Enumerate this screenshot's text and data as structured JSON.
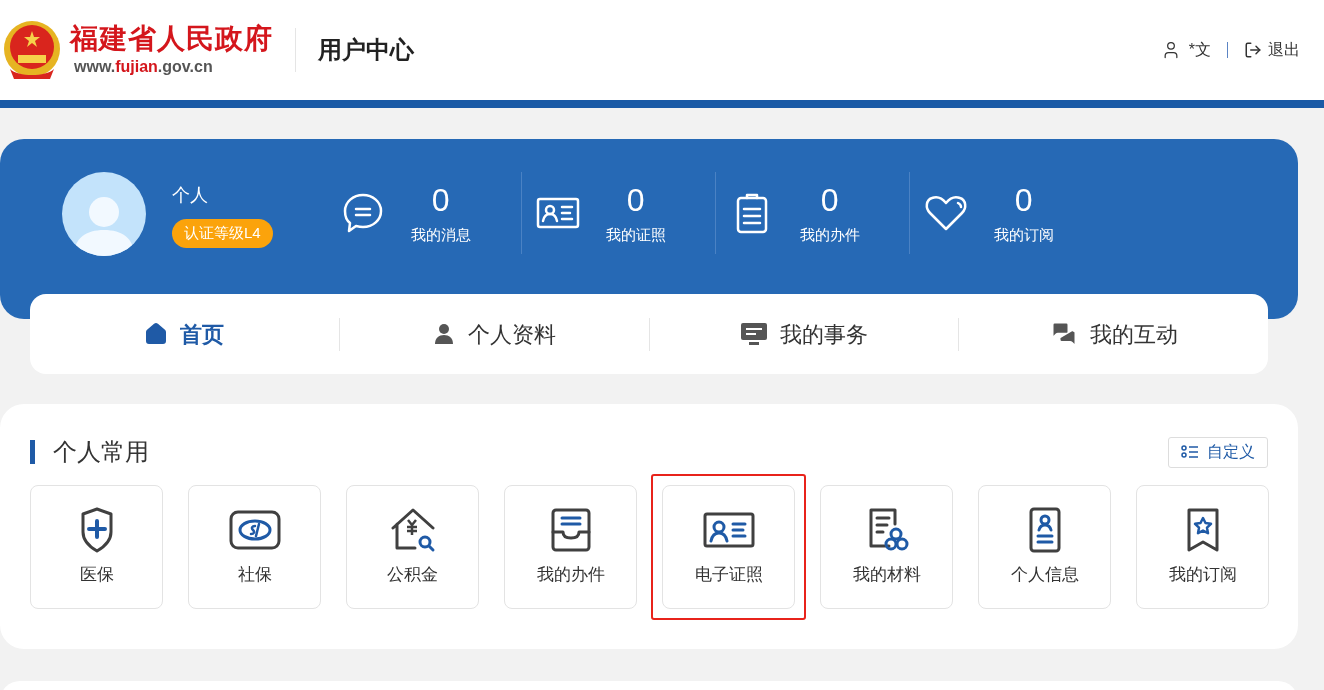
{
  "header": {
    "site_name": "福建省人民政府",
    "site_url_prefix": "www.",
    "site_url_domain": "fujian",
    "site_url_suffix": ".gov.cn",
    "section_title": "用户中心",
    "user_name": "*文",
    "logout": "退出"
  },
  "profile": {
    "type": "个人",
    "badge": "认证等级L4",
    "stats": [
      {
        "kind": "message",
        "value": "0",
        "label": "我的消息"
      },
      {
        "kind": "license",
        "value": "0",
        "label": "我的证照"
      },
      {
        "kind": "clipboard",
        "value": "0",
        "label": "我的办件"
      },
      {
        "kind": "heart",
        "value": "0",
        "label": "我的订阅"
      }
    ]
  },
  "nav_tabs": [
    {
      "kind": "home",
      "label": "首页",
      "selected": true
    },
    {
      "kind": "user",
      "label": "个人资料",
      "selected": false
    },
    {
      "kind": "affairs",
      "label": "我的事务",
      "selected": false
    },
    {
      "kind": "interaction",
      "label": "我的互动",
      "selected": false
    }
  ],
  "common": {
    "title": "个人常用",
    "customize": "自定义",
    "tiles": [
      {
        "kind": "medical",
        "label": "医保",
        "highlighted": false
      },
      {
        "kind": "social",
        "label": "社保",
        "highlighted": false
      },
      {
        "kind": "fund",
        "label": "公积金",
        "highlighted": false
      },
      {
        "kind": "inbox",
        "label": "我的办件",
        "highlighted": false
      },
      {
        "kind": "license",
        "label": "电子证照",
        "highlighted": true
      },
      {
        "kind": "materials",
        "label": "我的材料",
        "highlighted": false
      },
      {
        "kind": "person",
        "label": "个人信息",
        "highlighted": false
      },
      {
        "kind": "subscribe",
        "label": "我的订阅",
        "highlighted": false
      }
    ]
  }
}
